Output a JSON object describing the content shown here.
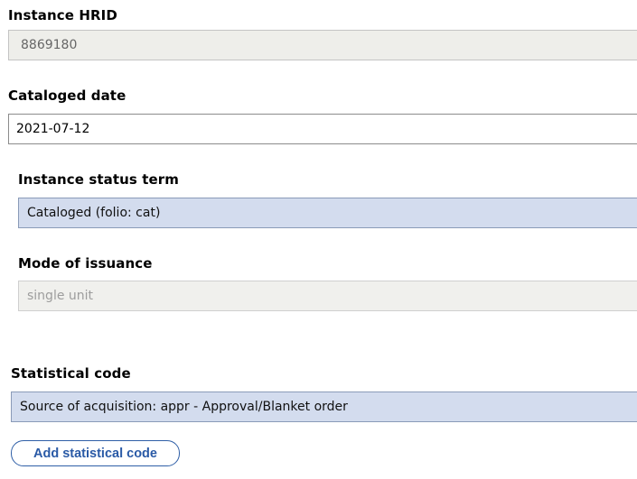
{
  "instance_hrid": {
    "label": "Instance HRID",
    "value": "8869180"
  },
  "cataloged_date": {
    "label": "Cataloged date",
    "value": "2021-07-12"
  },
  "instance_status_term": {
    "label": "Instance status term",
    "value": "Cataloged (folio: cat)"
  },
  "mode_of_issuance": {
    "label": "Mode of issuance",
    "value": "single unit"
  },
  "statistical_code": {
    "label": "Statistical code",
    "value": "Source of acquisition: appr - Approval/Blanket order",
    "add_button_label": "Add statistical code"
  }
}
